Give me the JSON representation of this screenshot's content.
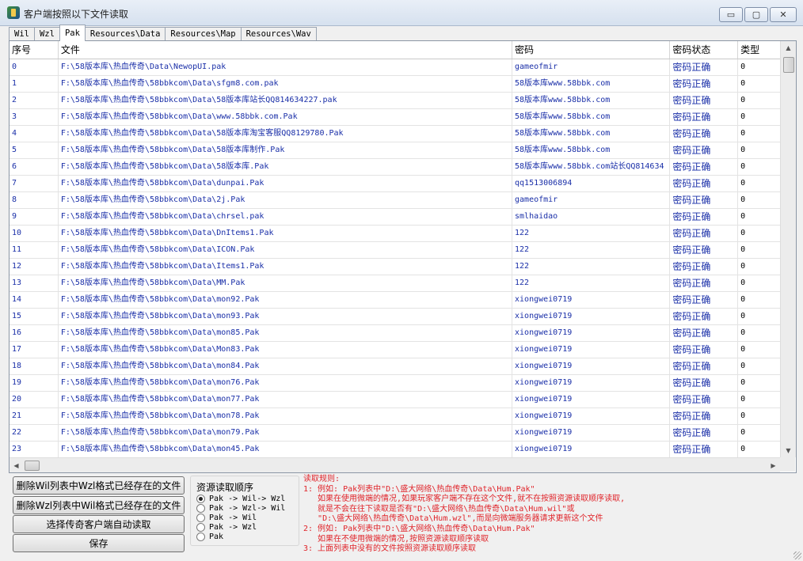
{
  "window": {
    "title": "客户端按照以下文件读取"
  },
  "window_buttons": {
    "minimize": "▭",
    "maximize": "▢",
    "close": "✕"
  },
  "tabs": [
    "Wil",
    "Wzl",
    "Pak",
    "Resources\\Data",
    "Resources\\Map",
    "Resources\\Wav"
  ],
  "active_tab": "Pak",
  "table": {
    "columns": [
      "序号",
      "文件",
      "密码",
      "密码状态",
      "类型"
    ],
    "rows": [
      [
        "0",
        "F:\\58版本库\\热血传奇\\Data\\NewopUI.pak",
        "gameofmir",
        "密码正确",
        "0"
      ],
      [
        "1",
        "F:\\58版本库\\热血传奇\\58bbkcom\\Data\\sfgm8.com.pak",
        "58版本库www.58bbk.com",
        "密码正确",
        "0"
      ],
      [
        "2",
        "F:\\58版本库\\热血传奇\\58bbkcom\\Data\\58版本库站长QQ814634227.pak",
        "58版本库www.58bbk.com",
        "密码正确",
        "0"
      ],
      [
        "3",
        "F:\\58版本库\\热血传奇\\58bbkcom\\Data\\www.58bbk.com.Pak",
        "58版本库www.58bbk.com",
        "密码正确",
        "0"
      ],
      [
        "4",
        "F:\\58版本库\\热血传奇\\58bbkcom\\Data\\58版本库淘宝客服QQ8129780.Pak",
        "58版本库www.58bbk.com",
        "密码正确",
        "0"
      ],
      [
        "5",
        "F:\\58版本库\\热血传奇\\58bbkcom\\Data\\58版本库制作.Pak",
        "58版本库www.58bbk.com",
        "密码正确",
        "0"
      ],
      [
        "6",
        "F:\\58版本库\\热血传奇\\58bbkcom\\Data\\58版本库.Pak",
        "58版本库www.58bbk.com站长QQ814634",
        "密码正确",
        "0"
      ],
      [
        "7",
        "F:\\58版本库\\热血传奇\\58bbkcom\\Data\\dunpai.Pak",
        "qq1513006894",
        "密码正确",
        "0"
      ],
      [
        "8",
        "F:\\58版本库\\热血传奇\\58bbkcom\\Data\\2j.Pak",
        "gameofmir",
        "密码正确",
        "0"
      ],
      [
        "9",
        "F:\\58版本库\\热血传奇\\58bbkcom\\Data\\chrsel.pak",
        "smlhaidao",
        "密码正确",
        "0"
      ],
      [
        "10",
        "F:\\58版本库\\热血传奇\\58bbkcom\\Data\\DnItems1.Pak",
        "122",
        "密码正确",
        "0"
      ],
      [
        "11",
        "F:\\58版本库\\热血传奇\\58bbkcom\\Data\\ICON.Pak",
        "122",
        "密码正确",
        "0"
      ],
      [
        "12",
        "F:\\58版本库\\热血传奇\\58bbkcom\\Data\\Items1.Pak",
        "122",
        "密码正确",
        "0"
      ],
      [
        "13",
        "F:\\58版本库\\热血传奇\\58bbkcom\\Data\\MM.Pak",
        "122",
        "密码正确",
        "0"
      ],
      [
        "14",
        "F:\\58版本库\\热血传奇\\58bbkcom\\Data\\mon92.Pak",
        "xiongwei0719",
        "密码正确",
        "0"
      ],
      [
        "15",
        "F:\\58版本库\\热血传奇\\58bbkcom\\Data\\mon93.Pak",
        "xiongwei0719",
        "密码正确",
        "0"
      ],
      [
        "16",
        "F:\\58版本库\\热血传奇\\58bbkcom\\Data\\mon85.Pak",
        "xiongwei0719",
        "密码正确",
        "0"
      ],
      [
        "17",
        "F:\\58版本库\\热血传奇\\58bbkcom\\Data\\Mon83.Pak",
        "xiongwei0719",
        "密码正确",
        "0"
      ],
      [
        "18",
        "F:\\58版本库\\热血传奇\\58bbkcom\\Data\\mon84.Pak",
        "xiongwei0719",
        "密码正确",
        "0"
      ],
      [
        "19",
        "F:\\58版本库\\热血传奇\\58bbkcom\\Data\\mon76.Pak",
        "xiongwei0719",
        "密码正确",
        "0"
      ],
      [
        "20",
        "F:\\58版本库\\热血传奇\\58bbkcom\\Data\\mon77.Pak",
        "xiongwei0719",
        "密码正确",
        "0"
      ],
      [
        "21",
        "F:\\58版本库\\热血传奇\\58bbkcom\\Data\\mon78.Pak",
        "xiongwei0719",
        "密码正确",
        "0"
      ],
      [
        "22",
        "F:\\58版本库\\热血传奇\\58bbkcom\\Data\\mon79.Pak",
        "xiongwei0719",
        "密码正确",
        "0"
      ],
      [
        "23",
        "F:\\58版本库\\热血传奇\\58bbkcom\\Data\\mon45.Pak",
        "xiongwei0719",
        "密码正确",
        "0"
      ]
    ]
  },
  "scroll_arrows": {
    "up": "▲",
    "down": "▼",
    "left": "◀",
    "right": "▶"
  },
  "buttons": {
    "delete_wil": "删除Wil列表中Wzl格式已经存在的文件",
    "delete_wzl": "删除Wzl列表中Wil格式已经存在的文件",
    "auto_read": "选择传奇客户端自动读取",
    "save": "保存"
  },
  "read_order": {
    "title": "资源读取顺序",
    "options": [
      "Pak -> Wil-> Wzl",
      "Pak -> Wzl-> Wil",
      "Pak -> Wil",
      "Pak -> Wzl",
      "Pak"
    ],
    "selected_index": 0
  },
  "rules": {
    "lines": [
      "读取规则:",
      "1: 例如: Pak列表中\"D:\\盛大网络\\热血传奇\\Data\\Hum.Pak\"",
      "   如果在使用微端的情况,如果玩家客户端不存在这个文件,就不在按照资源读取顺序读取,",
      "   就是不会在往下读取是否有\"D:\\盛大网络\\热血传奇\\Data\\Hum.wil\"或",
      "   \"D:\\盛大网络\\热血传奇\\Data\\Hum.wzl\",而是向微端服务器请求更新这个文件",
      "2: 例如: Pak列表中\"D:\\盛大网络\\热血传奇\\Data\\Hum.Pak\"",
      "   如果在不使用微端的情况,按照资源读取顺序读取",
      "3: 上面列表中没有的文件按照资源读取顺序读取"
    ],
    "color": "#e0242a"
  }
}
